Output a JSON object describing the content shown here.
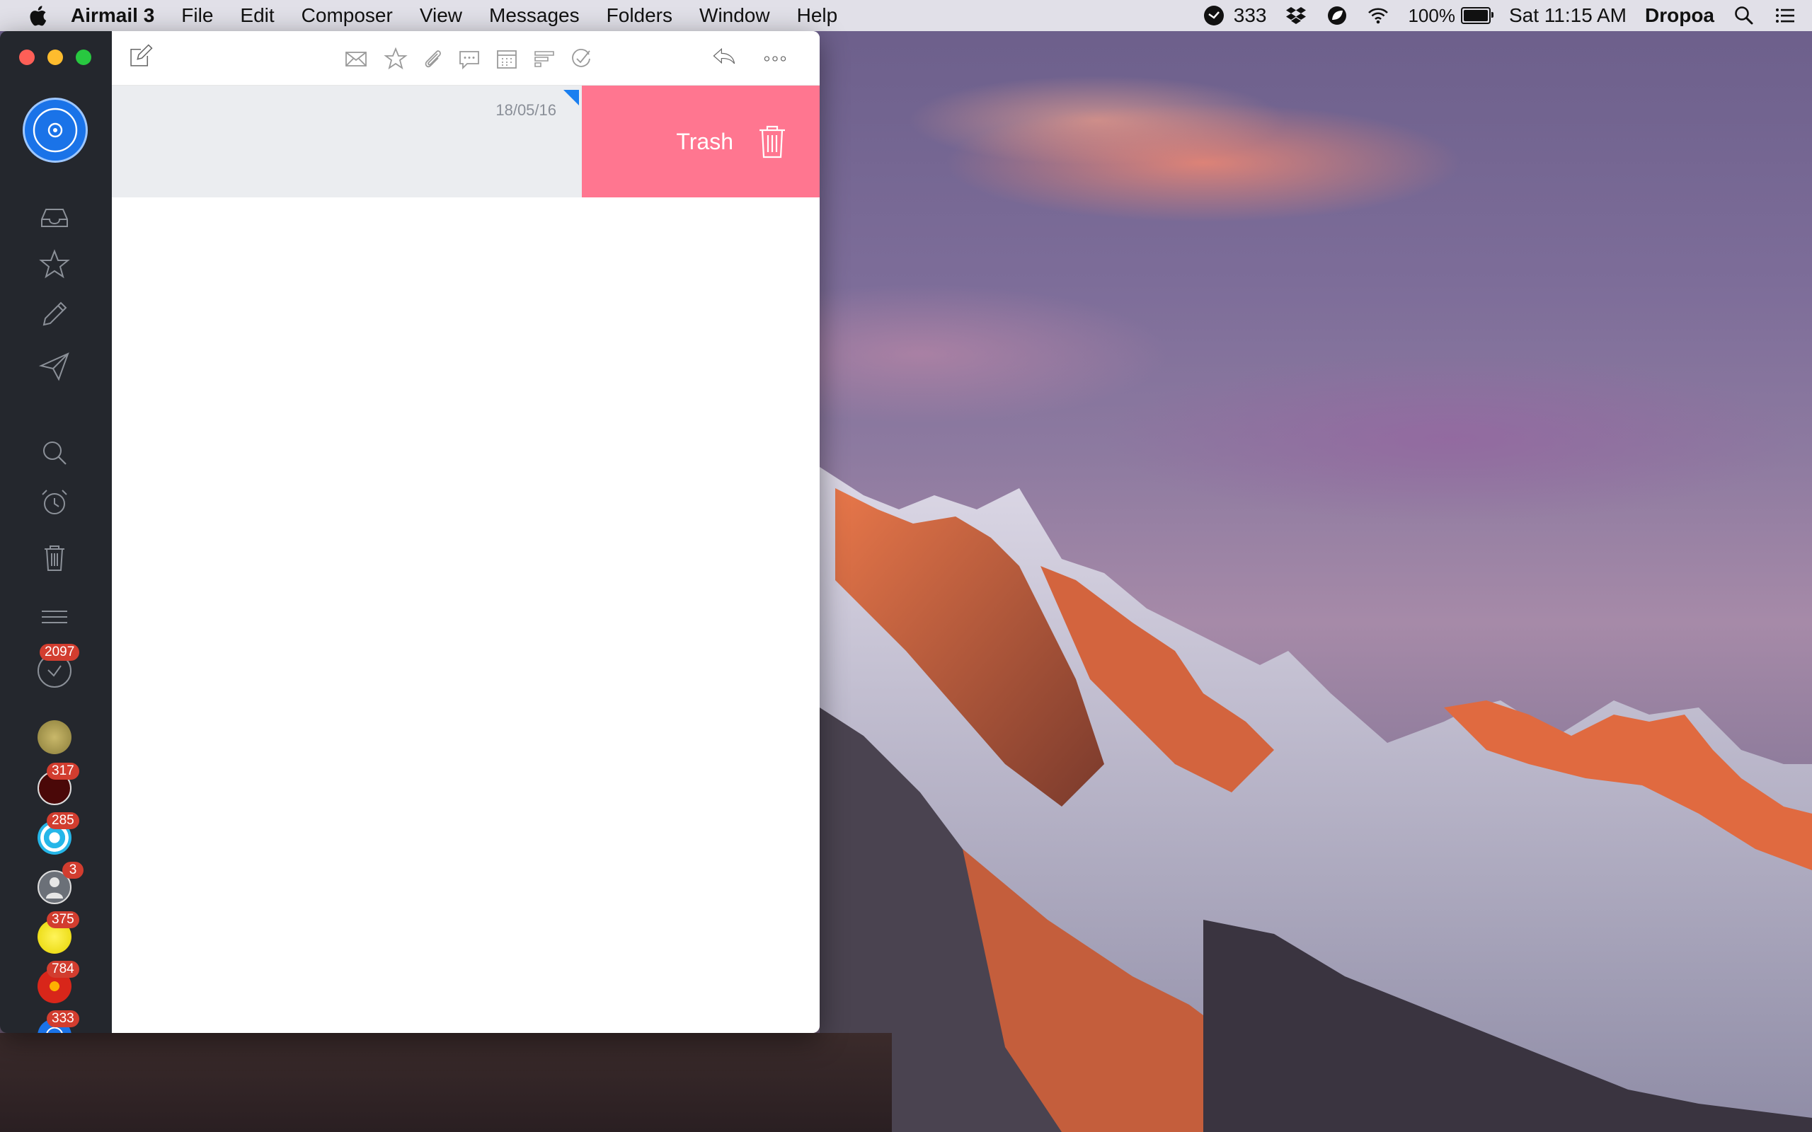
{
  "menubar": {
    "app_name": "Airmail 3",
    "menus": [
      "File",
      "Edit",
      "Composer",
      "View",
      "Messages",
      "Folders",
      "Window",
      "Help"
    ],
    "status": {
      "mail_count": "333",
      "battery": "100%",
      "clock": "Sat 11:15 AM",
      "user": "Dropoa"
    }
  },
  "sidebar": {
    "accounts": [
      {
        "badge": "2097",
        "color": "#2a2d33"
      },
      {
        "badge": "",
        "color": "#a79a5a"
      },
      {
        "badge": "317",
        "color": "#4a0808"
      },
      {
        "badge": "285",
        "color": "#25b6e8"
      },
      {
        "badge": "3",
        "color": "#9aa0a6"
      },
      {
        "badge": "375",
        "color": "#f2e21a"
      },
      {
        "badge": "784",
        "color": "#d8261a"
      },
      {
        "badge": "333",
        "color": "#1a73e8"
      }
    ]
  },
  "message_list": {
    "row": {
      "date": "18/05/16",
      "swipe_action_label": "Trash"
    }
  },
  "colors": {
    "trash_action": "#ff7690",
    "sidebar": "#24272d",
    "badge": "#d23d2f",
    "unread_flag": "#1a7ff0"
  }
}
